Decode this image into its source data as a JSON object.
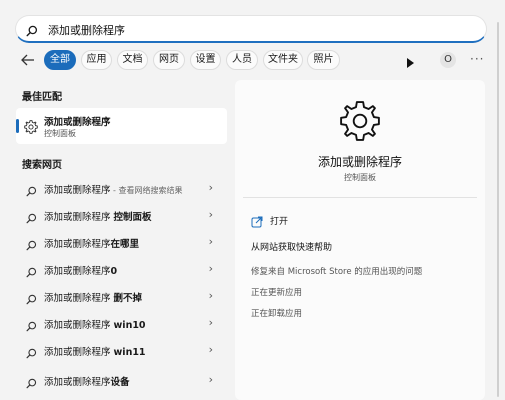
{
  "search": {
    "value": "添加或删除程序",
    "icon": "search-icon"
  },
  "filters": {
    "tabs": [
      "全部",
      "应用",
      "文档",
      "网页",
      "设置",
      "人员",
      "文件夹",
      "照片"
    ],
    "active_index": 0,
    "avatar_letter": "O",
    "more": "···"
  },
  "left": {
    "best_match_title": "最佳匹配",
    "best_match": {
      "title": "添加或删除程序",
      "subtitle": "控制面板"
    },
    "web_title": "搜索网页",
    "web_results": [
      {
        "normal": "添加或删除程序",
        "bold": "",
        "hint": " - 查看网络搜索结果"
      },
      {
        "normal": "添加或删除程序 ",
        "bold": "控制面板",
        "hint": ""
      },
      {
        "normal": "添加或删除程序",
        "bold": "在哪里",
        "hint": ""
      },
      {
        "normal": "添加或删除程序",
        "bold": "0",
        "hint": ""
      },
      {
        "normal": "添加或删除程序 ",
        "bold": "删不掉",
        "hint": ""
      },
      {
        "normal": "添加或删除程序 ",
        "bold": "win10",
        "hint": ""
      },
      {
        "normal": "添加或删除程序 ",
        "bold": "win11",
        "hint": ""
      },
      {
        "normal": "添加或删除程序",
        "bold": "设备",
        "hint": ""
      }
    ],
    "chevron": "›"
  },
  "right": {
    "app_title": "添加或删除程序",
    "app_subtitle": "控制面板",
    "open_label": "打开",
    "help_title": "从网站获取快速帮助",
    "help_links": [
      "修复来自 Microsoft Store 的应用出现的问题",
      "正在更新应用",
      "正在卸载应用"
    ]
  },
  "colors": {
    "accent": "#1b6cbb",
    "background": "#f3f3f3",
    "panel": "#fbfbfb"
  }
}
